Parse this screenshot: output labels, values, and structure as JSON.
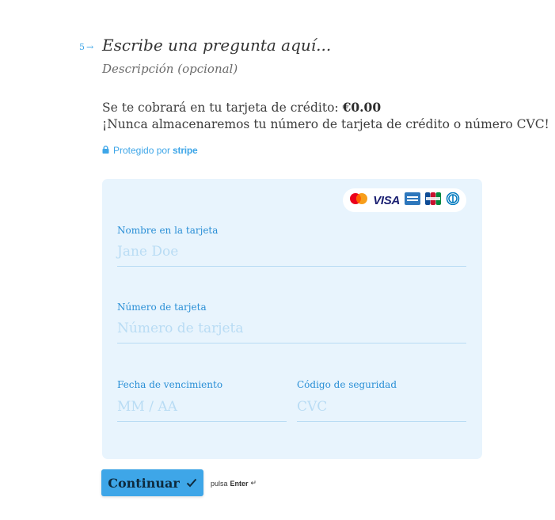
{
  "question": {
    "number": "5",
    "arrow_icon": "arrow-right-icon",
    "title": "Escribe una pregunta aquí...",
    "description": "Descripción (opcional)"
  },
  "payment": {
    "charge_text": "Se te cobrará en tu tarjeta de crédito: ",
    "amount": "€0.00",
    "never_store_text": "¡Nunca almacenaremos tu número de tarjeta de crédito o número CVC!",
    "protected_text": "Protegido por",
    "protected_brand": "stripe",
    "lock_icon": "lock-icon"
  },
  "card_form": {
    "brands": [
      "mastercard-icon",
      "visa-icon",
      "amex-icon",
      "jcb-icon",
      "diners-icon"
    ],
    "visa_label": "VISA",
    "name": {
      "label": "Nombre en la tarjeta",
      "placeholder": "Jane Doe"
    },
    "number": {
      "label": "Número de tarjeta",
      "placeholder": "Número de tarjeta"
    },
    "expiry": {
      "label": "Fecha de vencimiento",
      "placeholder": "MM / AA"
    },
    "cvc": {
      "label": "Código de seguridad",
      "placeholder": "CVC"
    }
  },
  "actions": {
    "continue_label": "Continuar",
    "check_icon": "check-icon",
    "hint_prefix": "pulsa",
    "hint_key": "Enter",
    "enter_icon": "return-icon"
  },
  "colors": {
    "accent": "#3ea6e8",
    "card_bg": "#e8f4fd",
    "placeholder": "#b9dcf4"
  }
}
